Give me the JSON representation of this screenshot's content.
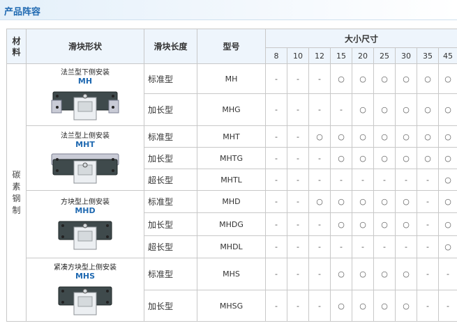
{
  "page_title": "产品阵容",
  "headers": {
    "material": "材料",
    "shape": "滑块形状",
    "length": "滑块长度",
    "model": "型号",
    "size": "大小尺寸"
  },
  "sizes": [
    "8",
    "10",
    "12",
    "15",
    "20",
    "25",
    "30",
    "35",
    "45"
  ],
  "material": "碳素钢制",
  "symbols": {
    "available": "○",
    "none": "-"
  },
  "groups": [
    {
      "caption": "法兰型下侧安装",
      "code": "MH",
      "icon": "flange-block-icon",
      "rows": [
        {
          "length": "标准型",
          "model": "MH",
          "values": [
            "-",
            "-",
            "-",
            "○",
            "○",
            "○",
            "○",
            "○",
            "○"
          ]
        },
        {
          "length": "加长型",
          "model": "MHG",
          "values": [
            "-",
            "-",
            "-",
            "-",
            "○",
            "○",
            "○",
            "○",
            "○"
          ]
        }
      ]
    },
    {
      "caption": "法兰型上侧安装",
      "code": "MHT",
      "icon": "flange-top-block-icon",
      "rows": [
        {
          "length": "标准型",
          "model": "MHT",
          "values": [
            "-",
            "-",
            "○",
            "○",
            "○",
            "○",
            "○",
            "○",
            "○"
          ]
        },
        {
          "length": "加长型",
          "model": "MHTG",
          "values": [
            "-",
            "-",
            "-",
            "○",
            "○",
            "○",
            "○",
            "○",
            "○"
          ]
        },
        {
          "length": "超长型",
          "model": "MHTL",
          "values": [
            "-",
            "-",
            "-",
            "-",
            "-",
            "-",
            "-",
            "-",
            "○"
          ]
        }
      ]
    },
    {
      "caption": "方块型上侧安装",
      "code": "MHD",
      "icon": "square-block-icon",
      "rows": [
        {
          "length": "标准型",
          "model": "MHD",
          "values": [
            "-",
            "-",
            "○",
            "○",
            "○",
            "○",
            "○",
            "-",
            "○"
          ]
        },
        {
          "length": "加长型",
          "model": "MHDG",
          "values": [
            "-",
            "-",
            "-",
            "○",
            "○",
            "○",
            "○",
            "-",
            "○"
          ]
        },
        {
          "length": "超长型",
          "model": "MHDL",
          "values": [
            "-",
            "-",
            "-",
            "-",
            "-",
            "-",
            "-",
            "-",
            "○"
          ]
        }
      ]
    },
    {
      "caption": "紧凑方块型上侧安装",
      "code": "MHS",
      "icon": "compact-block-icon",
      "rows": [
        {
          "length": "标准型",
          "model": "MHS",
          "values": [
            "-",
            "-",
            "-",
            "○",
            "○",
            "○",
            "○",
            "-",
            "-"
          ]
        },
        {
          "length": "加长型",
          "model": "MHSG",
          "values": [
            "-",
            "-",
            "-",
            "○",
            "○",
            "○",
            "○",
            "-",
            "-"
          ]
        }
      ]
    }
  ],
  "colors": {
    "title": "#1f69b1",
    "header_bg": "#eef5fc",
    "border": "#c8c8c8",
    "code": "#1f69b1"
  }
}
